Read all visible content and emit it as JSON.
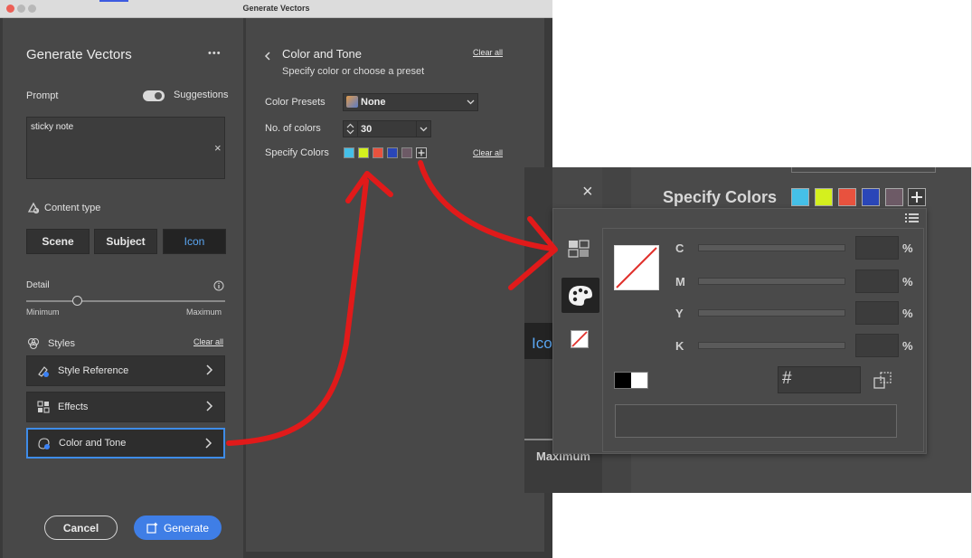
{
  "window": {
    "title": "Generate Vectors"
  },
  "left": {
    "panel_title": "Generate Vectors",
    "more_label": "•••",
    "prompt_label": "Prompt",
    "suggestions_label": "Suggestions",
    "prompt_value": "sticky note",
    "clear_x": "×",
    "content_type_label": "Content type",
    "content_types": [
      "Scene",
      "Subject",
      "Icon"
    ],
    "detail_label": "Detail",
    "detail_min": "Minimum",
    "detail_max": "Maximum",
    "detail_value": 0.26,
    "styles_label": "Styles",
    "styles_clear": "Clear all",
    "rows": [
      "Style Reference",
      "Effects",
      "Color and Tone"
    ],
    "cancel": "Cancel",
    "generate": "Generate"
  },
  "right": {
    "title": "Color and Tone",
    "subtitle": "Specify color or choose a preset",
    "clear_all_top": "Clear all",
    "presets_label": "Color Presets",
    "presets_value": "None",
    "num_colors_label": "No. of colors",
    "num_colors_value": "30",
    "specify_label": "Specify Colors",
    "clear_all_specify": "Clear all"
  },
  "swatches": [
    "#45c0e8",
    "#d4f01e",
    "#e8523e",
    "#2a46b8",
    "#6d5a66"
  ],
  "zoom": {
    "specify_label": "Specify Colors",
    "close_x": "×",
    "icon_fragment": "Ico",
    "maximum_fragment": "Maximum",
    "cmyk_labels": [
      "C",
      "M",
      "Y",
      "K"
    ],
    "percent": "%",
    "hex_symbol": "#"
  }
}
